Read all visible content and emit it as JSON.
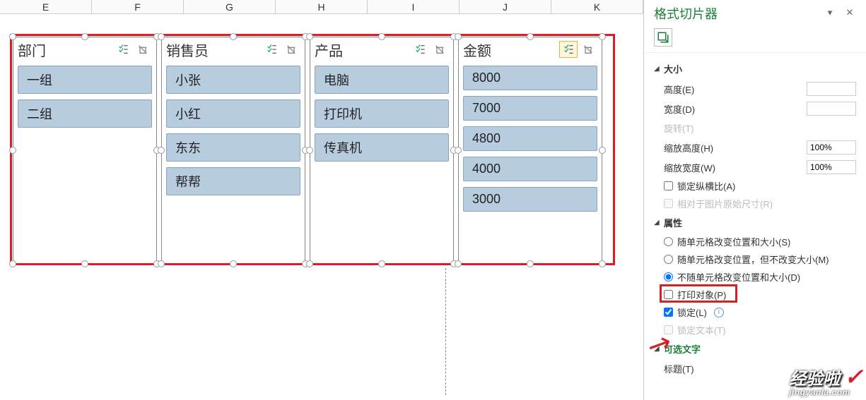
{
  "columns": [
    "E",
    "F",
    "G",
    "H",
    "I",
    "J",
    "K"
  ],
  "slicers": [
    {
      "title": "部门",
      "items": [
        "一组",
        "二组"
      ]
    },
    {
      "title": "销售员",
      "items": [
        "小张",
        "小红",
        "东东",
        "帮帮"
      ]
    },
    {
      "title": "产品",
      "items": [
        "电脑",
        "打印机",
        "传真机"
      ]
    },
    {
      "title": "金额",
      "items": [
        "8000",
        "7000",
        "4800",
        "4000",
        "3000"
      ],
      "multi": true
    }
  ],
  "panel": {
    "title": "格式切片器",
    "sections": {
      "size": {
        "label": "大小",
        "height_label": "高度(E)",
        "width_label": "宽度(D)",
        "rotate_label": "旋转(T)",
        "scale_h_label": "缩放高度(H)",
        "scale_w_label": "缩放宽度(W)",
        "scale_h": "100%",
        "scale_w": "100%",
        "lock_ratio": "锁定纵横比(A)",
        "relative_orig": "相对于图片原始尺寸(R)"
      },
      "props": {
        "label": "属性",
        "opt1": "随单元格改变位置和大小(S)",
        "opt2": "随单元格改变位置，但不改变大小(M)",
        "opt3": "不随单元格改变位置和大小(D)",
        "print": "打印对象(P)",
        "lock": "锁定(L)",
        "lock_text": "锁定文本(T)"
      },
      "alt": {
        "label": "可选文字",
        "title_label": "标题(T)"
      }
    }
  },
  "watermark": {
    "big": "经验啦",
    "small": "jingyanla.com"
  }
}
